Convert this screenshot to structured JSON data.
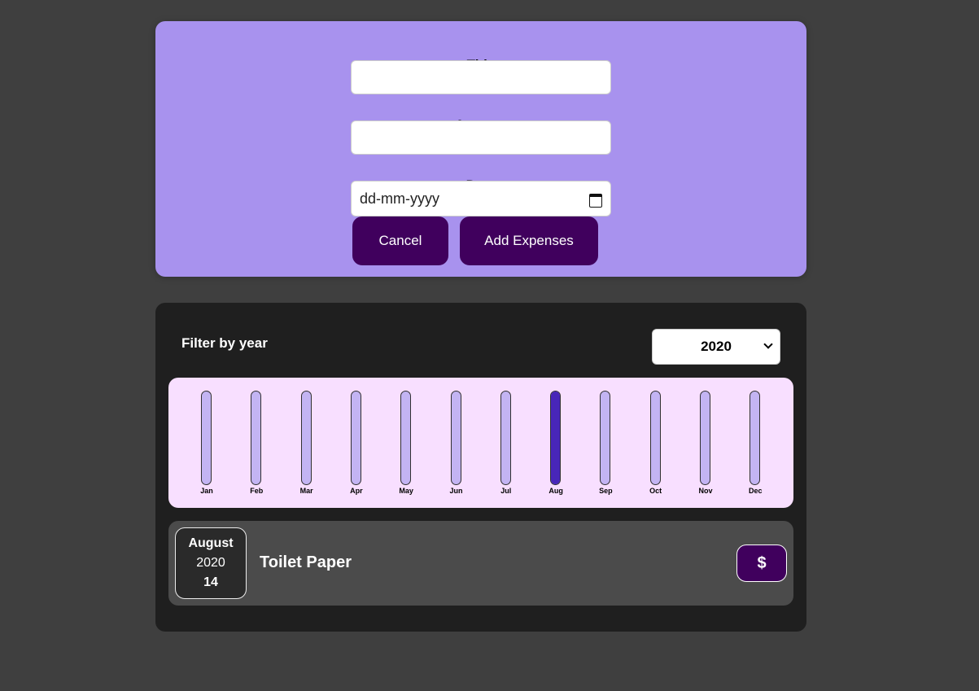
{
  "form": {
    "title_label": "Title",
    "title_value": "",
    "amount_label": "Amount",
    "amount_value": "",
    "date_label": "Date",
    "date_placeholder": "dd-mm-yyyy",
    "cancel_label": "Cancel",
    "submit_label": "Add Expenses"
  },
  "filter": {
    "label": "Filter by year",
    "selected_year": "2020"
  },
  "chart_data": {
    "type": "bar",
    "categories": [
      "Jan",
      "Feb",
      "Mar",
      "Apr",
      "May",
      "Jun",
      "Jul",
      "Aug",
      "Sep",
      "Oct",
      "Nov",
      "Dec"
    ],
    "values": [
      0,
      0,
      0,
      0,
      0,
      0,
      0,
      1,
      0,
      0,
      0,
      0
    ],
    "ylim": [
      0,
      1
    ]
  },
  "expenses": [
    {
      "month": "August",
      "year": "2020",
      "day": "14",
      "title": "Toilet Paper",
      "price": "$"
    }
  ],
  "colors": {
    "background": "#3f3f3f",
    "form_bg": "#a892ee",
    "button": "#40005d",
    "panel": "#1f1f1f",
    "chart_bg": "#f8dfff",
    "bar_track": "#c3b4f3",
    "bar_fill": "#4826b9",
    "item_bg": "#4b4b4b"
  },
  "icons": {
    "date_picker": "calendar-icon",
    "select": "chevron-down-icon"
  }
}
